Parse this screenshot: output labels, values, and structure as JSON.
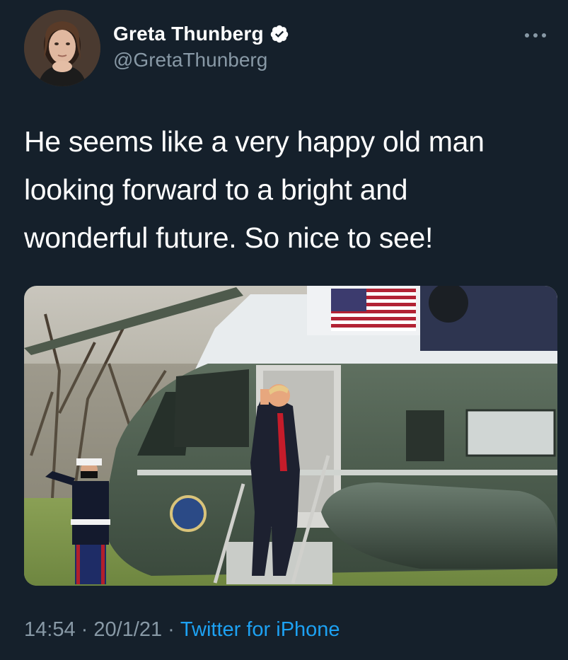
{
  "author": {
    "name": "Greta Thunberg",
    "handle": "@GretaThunberg",
    "verified": true,
    "avatar_icon": "profile-photo"
  },
  "tweet": {
    "text": "He seems like a very happy old man\nlooking forward to a bright and\nwonderful future. So nice to see!"
  },
  "media": {
    "type": "photo",
    "icon": "helicopter-photo"
  },
  "meta": {
    "time": "14:54",
    "separator": " · ",
    "date": "20/1/21",
    "source": "Twitter for iPhone"
  },
  "colors": {
    "background": "#15202b",
    "text": "#ffffff",
    "secondary": "#8899a6",
    "link": "#1da1f2"
  },
  "icons": {
    "more": "more-horizontal-icon",
    "verified": "verified-badge-icon"
  }
}
